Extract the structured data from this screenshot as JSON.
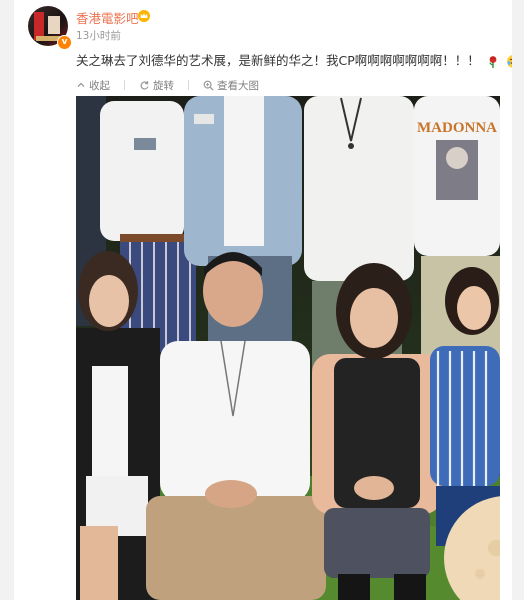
{
  "post": {
    "username": "香港電影吧",
    "time": "13小时前",
    "text": "关之琳去了刘德华的艺术展，是新鲜的华之！我CP啊啊啊啊啊啊啊！！！",
    "emojis": [
      "rose-emoji",
      "tears-of-joy-emoji"
    ]
  },
  "toolbar": {
    "collapse_label": "收起",
    "rotate_label": "旋转",
    "view_large_label": "查看大图"
  },
  "photo": {
    "shirt_text": "MADONNA"
  },
  "colors": {
    "username": "#eb7350",
    "text": "#333333",
    "meta": "#999999",
    "verified_badge": "#ff8200"
  }
}
